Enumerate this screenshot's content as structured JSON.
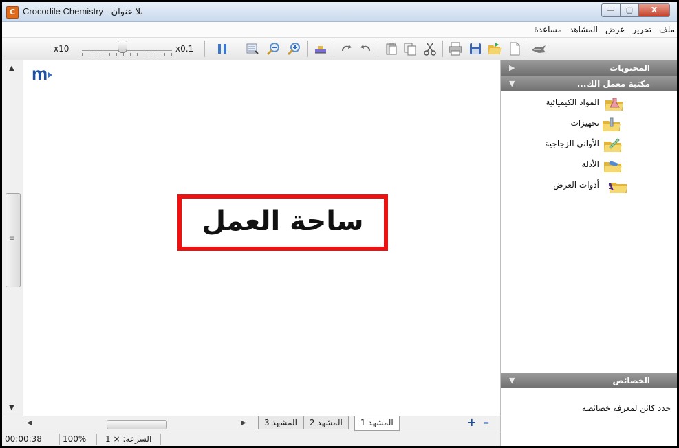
{
  "window": {
    "title": "Crocodile Chemistry - بلا عنوان",
    "app_icon_letter": "C",
    "buttons": {
      "minimize": "—",
      "maximize": "▢",
      "close": "X"
    }
  },
  "menu": [
    "ملف",
    "تحرير",
    "عرض",
    "المشاهد",
    "مساعدة"
  ],
  "toolbar": {
    "speed_max_label": "x10",
    "speed_min_label": "x0.1",
    "speed_slider_position": 0.4,
    "icons": [
      "pause-icon",
      "grid-select-icon",
      "zoom-out-icon",
      "zoom-in-icon",
      "scale-icon",
      "redo-icon",
      "undo-icon",
      "paste-icon",
      "copy-icon",
      "cut-icon",
      "print-icon",
      "save-icon",
      "open-icon",
      "new-icon",
      "croc-icon"
    ]
  },
  "workspace": {
    "label": "ساحة العمل"
  },
  "scenes": {
    "tabs": [
      "المشهد 3",
      "المشهد 2",
      "المشهد 1"
    ],
    "active_index": 2,
    "add": "+",
    "remove": "–"
  },
  "status": {
    "time": "00:00:38",
    "zoom": "100%",
    "speed": "السرعة: × 1"
  },
  "right_pane": {
    "contents_header": "المحتويات",
    "library_header": "مكتبة معمل الك...",
    "library_items": [
      {
        "label": "المواد الكيميائية",
        "icon": "chemicals-folder-icon",
        "color": "#e79aa1"
      },
      {
        "label": "تجهيزات",
        "icon": "equipment-folder-icon",
        "color": "#a6b7c8"
      },
      {
        "label": "الأواني الزجاجية",
        "icon": "glassware-folder-icon",
        "color": "#9fd1a3"
      },
      {
        "label": "الأدلة",
        "icon": "indicators-folder-icon",
        "color": "#4f89d8"
      },
      {
        "label": "أدوات العرض",
        "icon": "presentation-folder-icon",
        "color": "#6b47b5"
      }
    ],
    "properties_header": "الخصائص",
    "properties_hint": "حدد كائن لمعرفة خصائصه"
  }
}
